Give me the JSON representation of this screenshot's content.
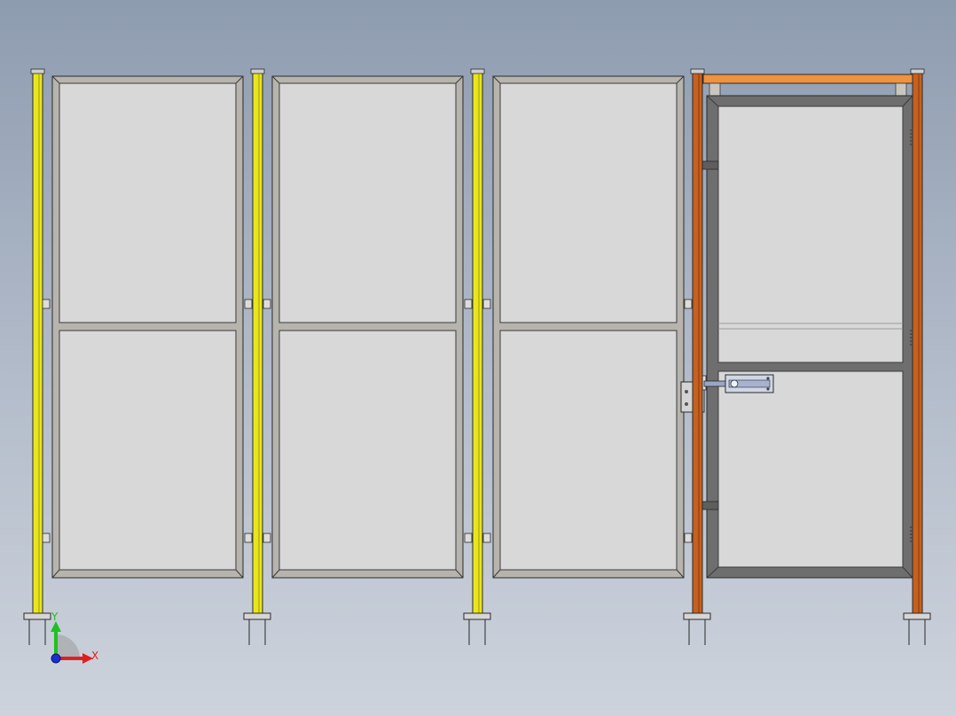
{
  "viewport": {
    "background_top": "#8e9cb0",
    "background_bottom": "#cdd3dc"
  },
  "colors": {
    "post_yellow": "#e9e51c",
    "post_orange": "#c8601e",
    "top_bar_orange": "#f0923e",
    "frame_grey": "#b7b4ad",
    "door_frame_dark": "#6e6e6e",
    "panel_fill": "#d8d8d8",
    "outline": "#2a2a2a"
  },
  "fence": {
    "panel_count": 3,
    "door_count": 1,
    "post_count": 5,
    "icons": [
      "fence-panel",
      "door",
      "latch",
      "hinge",
      "base-plate"
    ]
  },
  "triad": {
    "x_label": "X",
    "y_label": "Y",
    "x_color": "#e02020",
    "y_color": "#20c020",
    "origin_color": "#1a2fd0"
  }
}
